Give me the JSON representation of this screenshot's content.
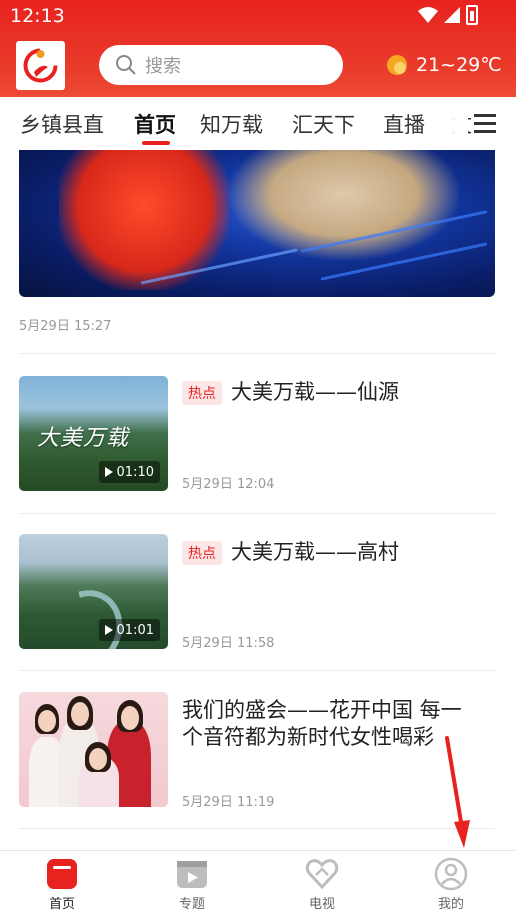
{
  "status_bar": {
    "time": "12:13"
  },
  "header": {
    "search_placeholder": "搜索",
    "weather": "21~29℃"
  },
  "tabs": [
    {
      "label": "乡镇县直"
    },
    {
      "label": "首页",
      "active": true
    },
    {
      "label": "知万载"
    },
    {
      "label": "汇天下"
    },
    {
      "label": "直播"
    },
    {
      "label": "文"
    }
  ],
  "banner": {
    "date": "5月29日 15:27"
  },
  "articles": [
    {
      "tag": "热点",
      "title": "大美万载——仙源",
      "date": "5月29日 12:04",
      "duration": "01:10",
      "thumb_text": "大美万载"
    },
    {
      "tag": "热点",
      "title": "大美万载——高村",
      "date": "5月29日 11:58",
      "duration": "01:01"
    },
    {
      "title_line1": "我们的盛会——花开中国 每一",
      "title_line2": "个音符都为新时代女性喝彩",
      "date": "5月29日 11:19"
    }
  ],
  "bottom_nav": [
    {
      "label": "首页",
      "active": true
    },
    {
      "label": "专题"
    },
    {
      "label": "电视"
    },
    {
      "label": "我的"
    }
  ],
  "colors": {
    "brand": "#e8221f",
    "tag_bg": "#fde6e6",
    "annotation_arrow": "#e8221f"
  }
}
